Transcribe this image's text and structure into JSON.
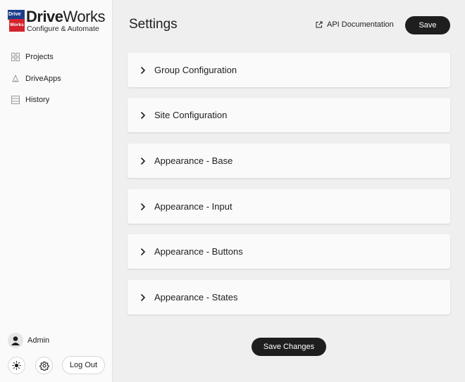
{
  "brand": {
    "mark_top": "Drive",
    "mark_bottom": "Works",
    "word_bold": "Drive",
    "word_regular": "Works",
    "tagline": "Configure & Automate",
    "colors": {
      "mark_top": "#1d3f8a",
      "mark_bottom": "#d3232c"
    }
  },
  "sidebar": {
    "items": [
      {
        "label": "Projects",
        "icon": "grid-icon"
      },
      {
        "label": "DriveApps",
        "icon": "drive-apps-icon"
      },
      {
        "label": "History",
        "icon": "history-icon"
      }
    ],
    "user": {
      "name": "Admin",
      "icon": "user-avatar-icon"
    },
    "theme_icon": "sun-icon",
    "settings_icon": "gear-icon",
    "logout_label": "Log Out"
  },
  "header": {
    "title": "Settings",
    "api_link_label": "API Documentation",
    "api_link_icon": "external-link-icon",
    "save_label": "Save"
  },
  "sections": [
    {
      "label": "Group Configuration"
    },
    {
      "label": "Site Configuration"
    },
    {
      "label": "Appearance - Base"
    },
    {
      "label": "Appearance - Input"
    },
    {
      "label": "Appearance - Buttons"
    },
    {
      "label": "Appearance - States"
    }
  ],
  "footer": {
    "save_changes_label": "Save Changes"
  },
  "colors": {
    "accent": "#1e1e1e",
    "background": "#efefef",
    "panel": "#fafafa"
  }
}
